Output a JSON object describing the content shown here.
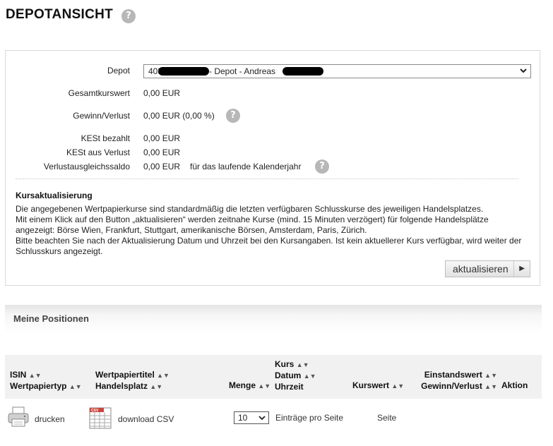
{
  "page": {
    "title": "DEPOTANSICHT",
    "help_glyph": "?"
  },
  "depot": {
    "labels": {
      "depot": "Depot",
      "gesamtkurswert": "Gesamtkurswert",
      "gewinn_verlust": "Gewinn/Verlust",
      "kest_bezahlt": "KESt bezahlt",
      "kest_verlust": "KESt aus Verlust",
      "verlustausgleich": "Verlustausgleichssaldo"
    },
    "select_value_prefix": "403",
    "select_value_middle": "- Depot - Andreas",
    "values": {
      "gesamtkurswert": "0,00 EUR",
      "gewinn_verlust": "0,00 EUR (0,00 %)",
      "kest_bezahlt": "0,00 EUR",
      "kest_verlust": "0,00 EUR",
      "verlustausgleich": "0,00 EUR",
      "verlustausgleich_note": "für das laufende Kalenderjahr"
    }
  },
  "kursaktualisierung": {
    "title": "Kursaktualisierung",
    "line1": "Die angegebenen Wertpapierkurse sind standardmäßig die letzten verfügbaren Schlusskurse des jeweiligen Handelsplatzes.",
    "line2": "Mit einem Klick auf den Button „aktualisieren“ werden zeitnahe Kurse (mind. 15 Minuten verzögert) für folgende Handelsplätze angezeigt: Börse Wien, Frankfurt, Stuttgart, amerikanische Börsen, Amsterdam, Paris, Zürich.",
    "line3": "Bitte beachten Sie nach der Aktualisierung Datum und Uhrzeit bei den Kursangaben. Ist kein aktuellerer Kurs verfügbar, wird weiter der Schlusskurs angezeigt.",
    "button_label": "aktualisieren",
    "button_arrow": "▶"
  },
  "positions": {
    "title": "Meine Positionen",
    "sort_glyph": "▲▼",
    "headers": {
      "isin": "ISIN",
      "wertpapiertyp": "Wertpapiertyp",
      "wertpapiertitel": "Wertpapiertitel",
      "handelsplatz": "Handelsplatz",
      "menge": "Menge",
      "kurs": "Kurs",
      "datum": "Datum",
      "uhrzeit": "Uhrzeit",
      "kurswert": "Kurswert",
      "einstandswert": "Einstandswert",
      "gewinn_verlust": "Gewinn/Verlust",
      "aktion": "Aktion"
    },
    "toolbar": {
      "print_label": "drucken",
      "csv_label": "download CSV",
      "csv_icon_text": "CSV",
      "per_page_value": "10",
      "per_page_label": "Einträge pro Seite",
      "page_label": "Seite"
    }
  }
}
